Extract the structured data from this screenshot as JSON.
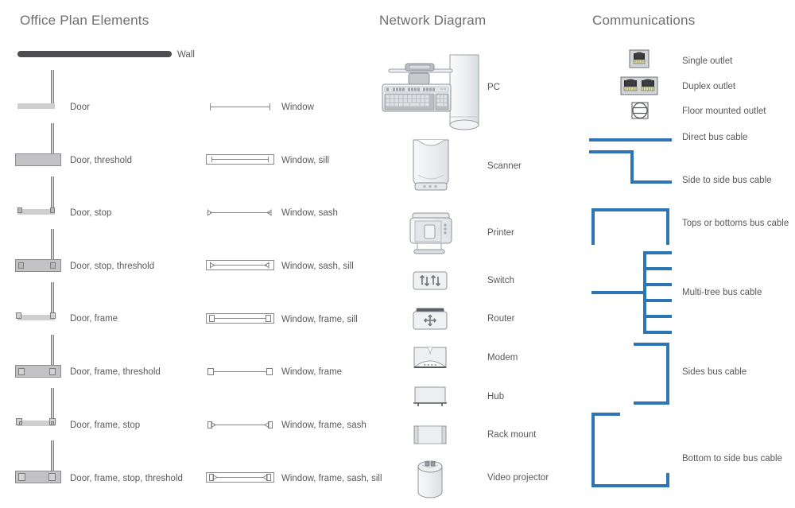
{
  "sections": {
    "office": {
      "title": "Office Plan Elements",
      "items": [
        {
          "label": "Wall",
          "icon": "wall-symbol"
        },
        {
          "label": "Door",
          "icon": "door-symbol"
        },
        {
          "label": "Door, threshold",
          "icon": "door-threshold-symbol"
        },
        {
          "label": "Door, stop",
          "icon": "door-stop-symbol"
        },
        {
          "label": "Door, stop, threshold",
          "icon": "door-stop-threshold-symbol"
        },
        {
          "label": "Door, frame",
          "icon": "door-frame-symbol"
        },
        {
          "label": "Door, frame, threshold",
          "icon": "door-frame-threshold-symbol"
        },
        {
          "label": "Door, frame, stop",
          "icon": "door-frame-stop-symbol"
        },
        {
          "label": "Door, frame, stop, threshold",
          "icon": "door-frame-stop-threshold-symbol"
        }
      ],
      "windows": [
        {
          "label": "Window",
          "icon": "window-symbol"
        },
        {
          "label": "Window, sill",
          "icon": "window-sill-symbol"
        },
        {
          "label": "Window, sash",
          "icon": "window-sash-symbol"
        },
        {
          "label": "Window, sash, sill",
          "icon": "window-sash-sill-symbol"
        },
        {
          "label": "Window, frame, sill",
          "icon": "window-frame-sill-symbol"
        },
        {
          "label": "Window, frame",
          "icon": "window-frame-symbol"
        },
        {
          "label": "Window, frame, sash",
          "icon": "window-frame-sash-symbol"
        },
        {
          "label": "Window, frame, sash, sill",
          "icon": "window-frame-sash-sill-symbol"
        }
      ]
    },
    "network": {
      "title": "Network Diagram",
      "items": [
        {
          "label": "PC",
          "icon": "pc-icon"
        },
        {
          "label": "Scanner",
          "icon": "scanner-icon"
        },
        {
          "label": "Printer",
          "icon": "printer-icon"
        },
        {
          "label": "Switch",
          "icon": "switch-icon"
        },
        {
          "label": "Router",
          "icon": "router-icon"
        },
        {
          "label": "Modem",
          "icon": "modem-icon"
        },
        {
          "label": "Hub",
          "icon": "hub-icon"
        },
        {
          "label": "Rack mount",
          "icon": "rack-mount-icon"
        },
        {
          "label": "Video projector",
          "icon": "video-projector-icon"
        }
      ]
    },
    "communications": {
      "title": "Communications",
      "outlets": [
        {
          "label": "Single outlet",
          "icon": "single-outlet-icon"
        },
        {
          "label": "Duplex outlet",
          "icon": "duplex-outlet-icon"
        },
        {
          "label": "Floor mounted outlet",
          "icon": "floor-mounted-outlet-icon"
        }
      ],
      "cables": [
        {
          "label": "Direct bus cable",
          "icon": "direct-bus-cable"
        },
        {
          "label": "Side to side bus cable",
          "icon": "side-to-side-bus-cable"
        },
        {
          "label": "Tops or bottoms bus cable",
          "icon": "tops-or-bottoms-bus-cable"
        },
        {
          "label": "Multi-tree bus cable",
          "icon": "multi-tree-bus-cable"
        },
        {
          "label": "Sides bus cable",
          "icon": "sides-bus-cable"
        },
        {
          "label": "Bottom to side bus cable",
          "icon": "bottom-to-side-bus-cable"
        }
      ]
    }
  },
  "colors": {
    "cable_blue": "#2e75b6",
    "wall_dark": "#4d4d4f",
    "text_gray": "#58595b",
    "title_gray": "#6d6e71",
    "symbol_outline": "#8a8a8d"
  }
}
